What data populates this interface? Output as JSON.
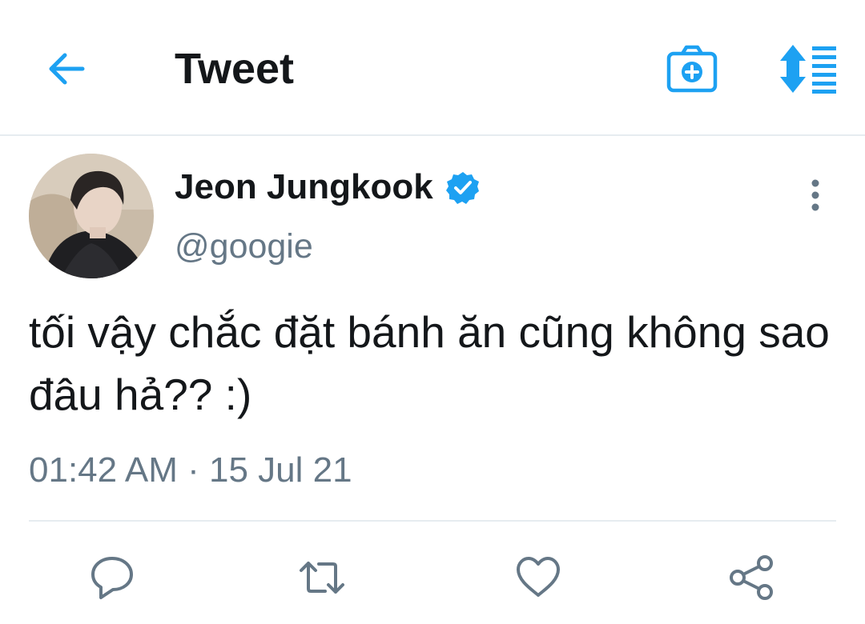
{
  "header": {
    "title": "Tweet",
    "back_icon": "arrow-left-icon",
    "camera_icon": "camera-plus-icon",
    "sort_icon": "sort-list-icon"
  },
  "tweet": {
    "display_name": "Jeon Jungkook",
    "verified": true,
    "handle": "@googie",
    "text": "tối vậy chắc đặt bánh ăn cũng không sao đâu hả?? :)",
    "timestamp": "01:42 AM · 15 Jul 21",
    "more_icon": "more-vertical-icon"
  },
  "actions": [
    {
      "name": "reply",
      "icon": "reply-bubble-icon"
    },
    {
      "name": "retweet",
      "icon": "retweet-icon"
    },
    {
      "name": "like",
      "icon": "heart-icon"
    },
    {
      "name": "share",
      "icon": "share-icon"
    }
  ],
  "colors": {
    "accent": "#1da1f2",
    "text_primary": "#14171a",
    "text_secondary": "#657786",
    "divider": "#e6ecf0"
  }
}
